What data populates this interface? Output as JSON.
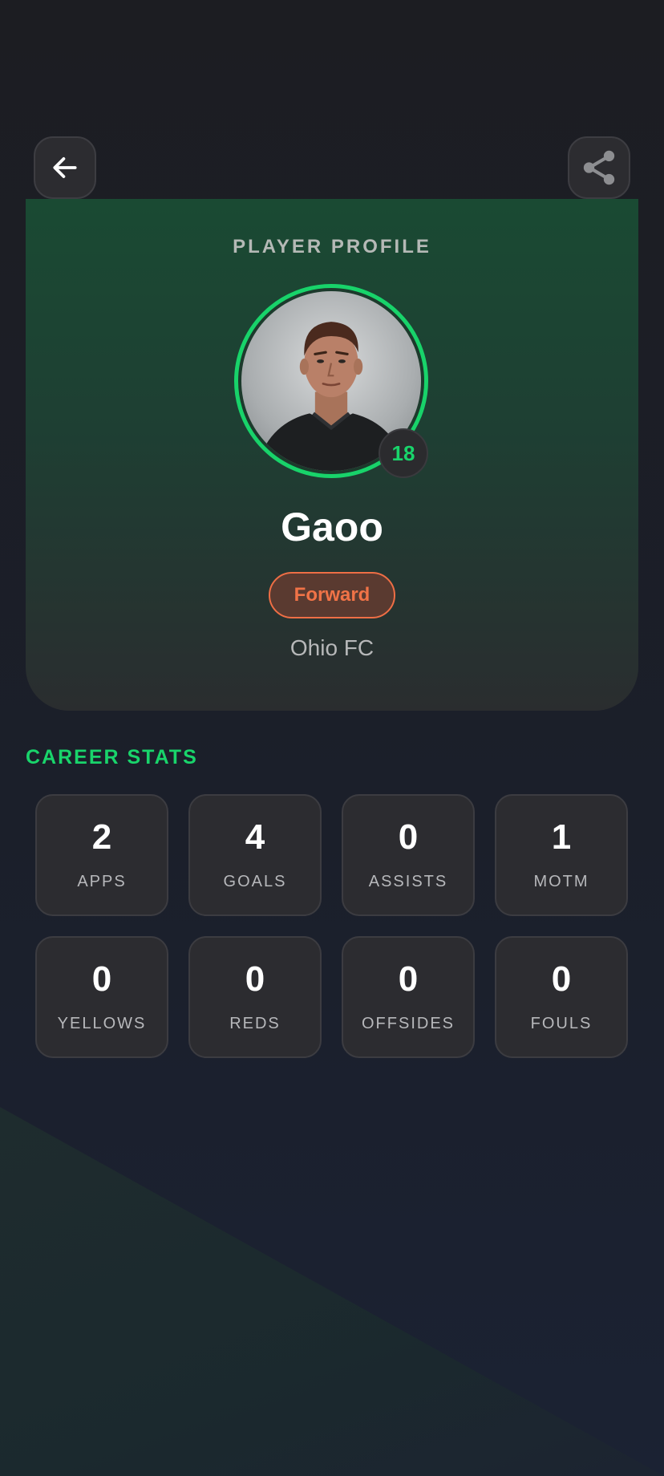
{
  "header": {
    "back_icon": "arrow-left-icon",
    "share_icon": "share-icon"
  },
  "profile": {
    "label": "PLAYER PROFILE",
    "name": "Gaoo",
    "number": "18",
    "position": "Forward",
    "club": "Ohio FC",
    "colors": {
      "accent": "#19d46b",
      "position": "#f07347"
    }
  },
  "stats": {
    "title": "CAREER STATS",
    "items": [
      {
        "value": "2",
        "label": "APPS"
      },
      {
        "value": "4",
        "label": "GOALS"
      },
      {
        "value": "0",
        "label": "ASSISTS"
      },
      {
        "value": "1",
        "label": "MOTM"
      },
      {
        "value": "0",
        "label": "YELLOWS"
      },
      {
        "value": "0",
        "label": "REDS"
      },
      {
        "value": "0",
        "label": "OFFSIDES"
      },
      {
        "value": "0",
        "label": "FOULS"
      }
    ]
  }
}
